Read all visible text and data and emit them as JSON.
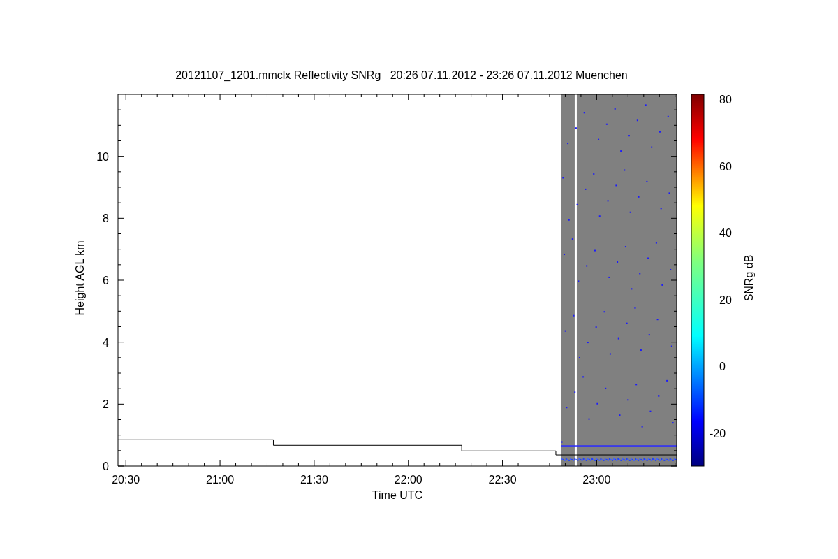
{
  "figure": {
    "title": "20121107_1201.mmclx Reflectivity SNRg   20:26 07.11.2012 - 23:26 07.11.2012 Muenchen",
    "chart_data": {
      "type": "line",
      "xlabel": "Time UTC",
      "ylabel": "Height AGL km",
      "xlim": [
        20.4583,
        23.425
      ],
      "ylim": [
        0,
        12
      ],
      "x": [
        20.4583,
        21.2833,
        21.2833,
        22.2833,
        22.2833,
        22.7833,
        22.7833,
        23.425
      ],
      "series": [
        {
          "color": "#000000",
          "values": [
            0.85,
            0.85,
            0.67,
            0.67,
            0.49,
            0.49,
            0.36,
            0.36
          ]
        }
      ],
      "xticks": [
        {
          "value": 20.5,
          "label": "20:30"
        },
        {
          "value": 21,
          "label": "21:00"
        },
        {
          "value": 21.5,
          "label": "21:30"
        },
        {
          "value": 22,
          "label": "22:00"
        },
        {
          "value": 22.5,
          "label": "22:30"
        },
        {
          "value": 23,
          "label": "23:00"
        }
      ],
      "yticks": [
        {
          "value": 0,
          "label": "0"
        },
        {
          "value": 2,
          "label": "2"
        },
        {
          "value": 4,
          "label": "4"
        },
        {
          "value": 6,
          "label": "6"
        },
        {
          "value": 8,
          "label": "8"
        },
        {
          "value": 10,
          "label": "10"
        }
      ]
    },
    "colorbar": {
      "label": "SNRg dB",
      "ticks": [
        "80",
        "60",
        "40",
        "20",
        "0",
        "-20"
      ]
    }
  }
}
